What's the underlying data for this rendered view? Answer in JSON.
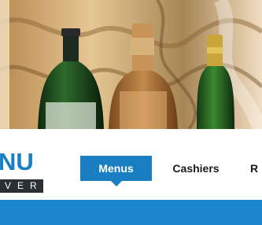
{
  "logo": {
    "main": "NU",
    "sub": "VER"
  },
  "nav": {
    "items": [
      {
        "label": "Menus"
      },
      {
        "label": "Cashiers"
      },
      {
        "label": "R"
      }
    ]
  },
  "colors": {
    "accent": "#1a7fc2",
    "band": "#1a86cf",
    "logo_sub_bg": "#2b3035"
  },
  "hero": {
    "image": "liquor-bottles-photo"
  }
}
